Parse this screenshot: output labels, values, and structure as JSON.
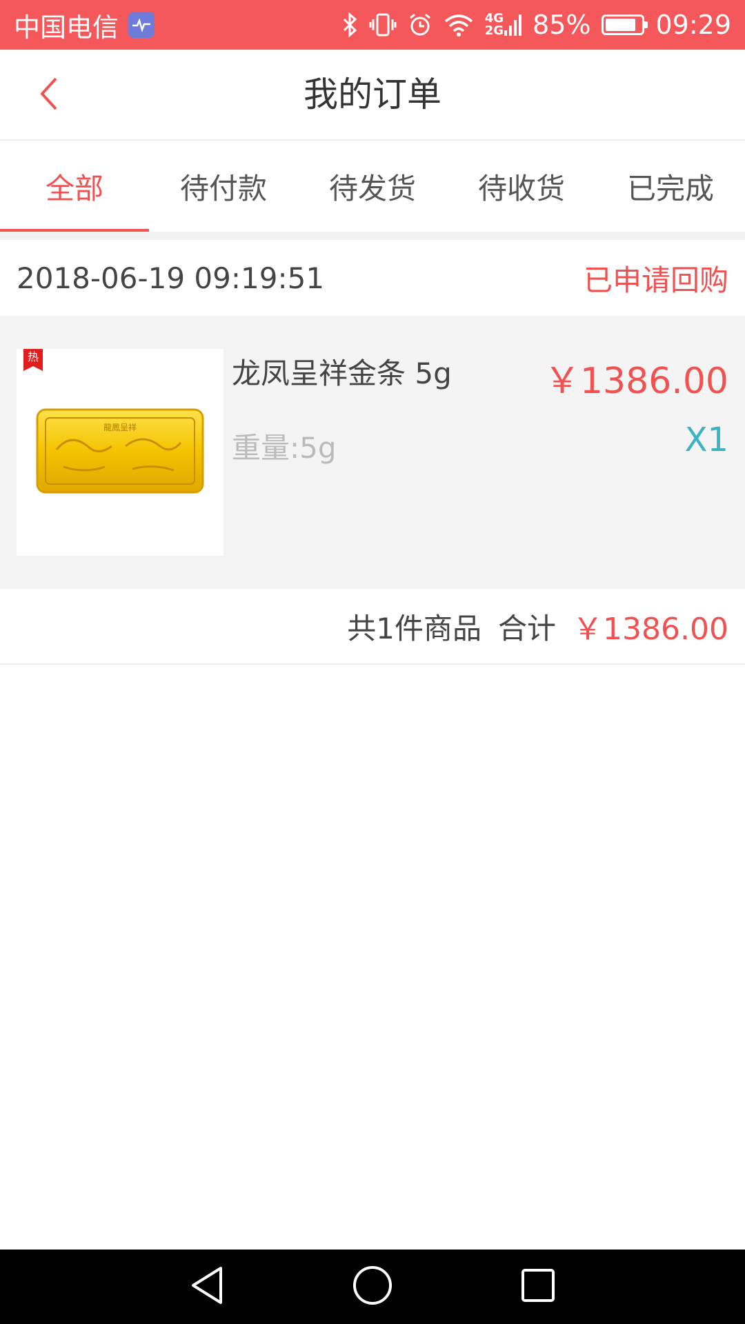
{
  "status_bar": {
    "carrier": "中国电信",
    "net_top": "4G",
    "net_bottom": "2G",
    "battery": "85%",
    "battery_level": 0.85,
    "time": "09:29"
  },
  "header": {
    "title": "我的订单"
  },
  "tabs": [
    {
      "label": "全部",
      "active": true
    },
    {
      "label": "待付款",
      "active": false
    },
    {
      "label": "待发货",
      "active": false
    },
    {
      "label": "待收货",
      "active": false
    },
    {
      "label": "已完成",
      "active": false
    }
  ],
  "order": {
    "time": "2018-06-19 09:19:51",
    "status": "已申请回购",
    "item": {
      "badge": "热",
      "image_caption": "龍鳳呈祥",
      "name": "龙凤呈祥金条 5g",
      "weight": "重量:5g",
      "price": "￥1386.00",
      "quantity": "X1"
    },
    "summary": {
      "count_text": "共1件商品",
      "total_label": "合计",
      "total_amount": "￥1386.00"
    }
  },
  "colors": {
    "status_bar_bg": "#f4585a",
    "accent_red": "#f05151",
    "qty_teal": "#3bb3c3"
  },
  "icons": {
    "back": "chevron-left-icon",
    "nav_back": "triangle-back-icon",
    "nav_home": "circle-home-icon",
    "nav_recent": "square-recent-icon"
  }
}
